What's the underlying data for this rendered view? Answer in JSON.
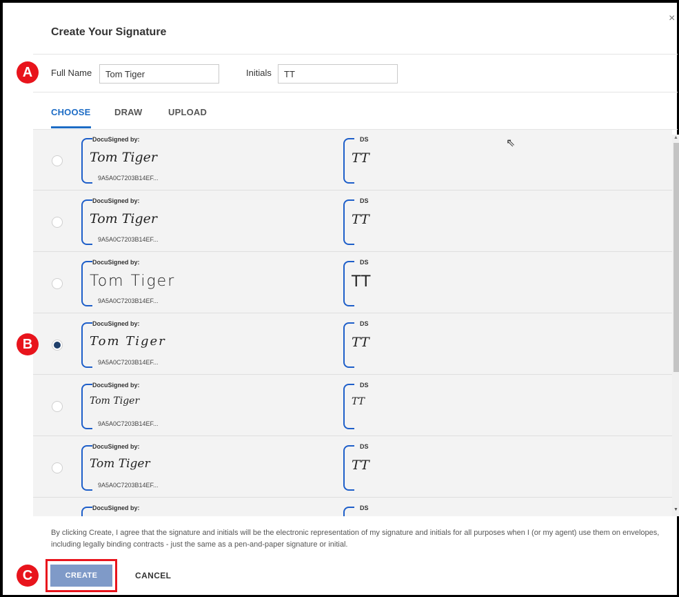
{
  "dialog": {
    "title": "Create Your Signature",
    "close_glyph": "×"
  },
  "fields": {
    "full_name_label": "Full Name",
    "full_name_value": "Tom Tiger",
    "initials_label": "Initials",
    "initials_value": "TT"
  },
  "tabs": [
    {
      "label": "CHOOSE",
      "active": true
    },
    {
      "label": "DRAW",
      "active": false
    },
    {
      "label": "UPLOAD",
      "active": false
    }
  ],
  "signature_options": [
    {
      "signed_by": "DocuSigned by:",
      "signature": "Tom Tiger",
      "id": "9A5A0C7203B14EF...",
      "ds": "DS",
      "initials": "TT",
      "selected": false
    },
    {
      "signed_by": "DocuSigned by:",
      "signature": "Tom Tiger",
      "id": "9A5A0C7203B14EF...",
      "ds": "DS",
      "initials": "TT",
      "selected": false
    },
    {
      "signed_by": "DocuSigned by:",
      "signature": "Tom Tiger",
      "id": "9A5A0C7203B14EF...",
      "ds": "DS",
      "initials": "TT",
      "selected": false
    },
    {
      "signed_by": "DocuSigned by:",
      "signature": "Tom Tiger",
      "id": "9A5A0C7203B14EF...",
      "ds": "DS",
      "initials": "TT",
      "selected": true
    },
    {
      "signed_by": "DocuSigned by:",
      "signature": "Tom Tiger",
      "id": "9A5A0C7203B14EF...",
      "ds": "DS",
      "initials": "TT",
      "selected": false
    },
    {
      "signed_by": "DocuSigned by:",
      "signature": "Tom Tiger",
      "id": "9A5A0C7203B14EF...",
      "ds": "DS",
      "initials": "TT",
      "selected": false
    },
    {
      "signed_by": "DocuSigned by:",
      "signature": "",
      "id": "",
      "ds": "DS",
      "initials": "",
      "selected": false
    }
  ],
  "disclaimer": "By clicking Create, I agree that the signature and initials will be the electronic representation of my signature and initials for all purposes when I (or my agent) use them on envelopes, including legally binding contracts - just the same as a pen-and-paper signature or initial.",
  "buttons": {
    "create": "CREATE",
    "cancel": "CANCEL"
  },
  "callouts": {
    "a": "A",
    "b": "B",
    "c": "C"
  },
  "colors": {
    "accent": "#1d6cc5",
    "callout": "#e8141c",
    "create_button": "#7f9ac8",
    "signature_bracket": "#1d5ec9"
  }
}
